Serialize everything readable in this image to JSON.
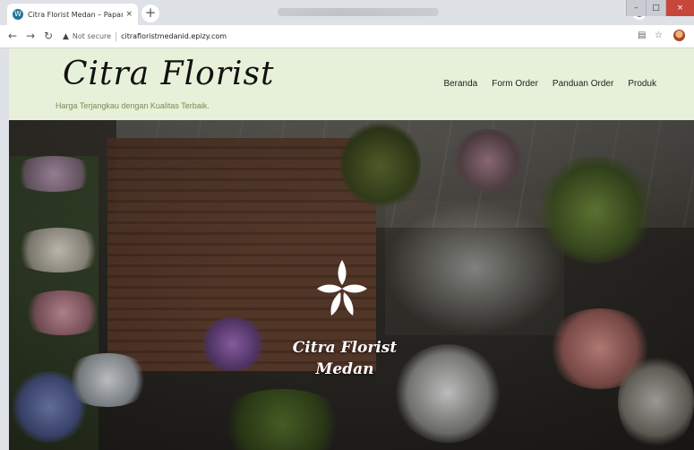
{
  "browser": {
    "tab_title": "Citra Florist Medan – Papan Bun",
    "tab_close": "×",
    "new_tab": "+",
    "security_label": "Not secure",
    "url": "citrafloristmedanid.epizy.com",
    "window_controls": [
      "–",
      "□",
      "×"
    ]
  },
  "site": {
    "logo": "Citra Florist",
    "tagline": "Harga Terjangkau dengan Kualitas Terbaik.",
    "menu": [
      "Beranda",
      "Form Order",
      "Panduan Order",
      "Produk"
    ]
  },
  "hero": {
    "line1": "Citra Florist",
    "line2": "Medan"
  },
  "colors": {
    "header_bg": "#e7f0d8",
    "tagline": "#7a8a5a"
  }
}
